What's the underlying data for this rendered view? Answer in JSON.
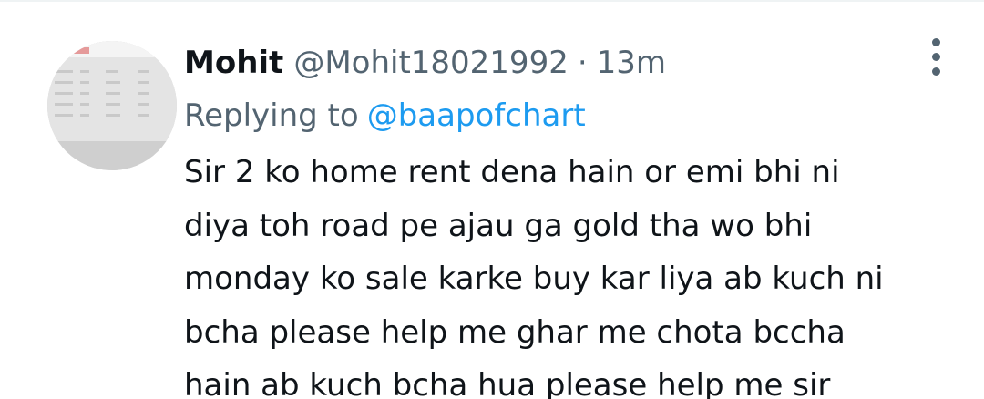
{
  "tweet": {
    "author_name": "Mohit",
    "author_handle": "@Mohit18021992",
    "separator": "·",
    "timestamp": "13m",
    "reply_prefix": "Replying to",
    "reply_handle": "@baapofchart",
    "body_lines": [
      "Sir 2 ko home rent dena hain or emi bhi ni",
      "diya toh road pe ajau ga gold tha wo bhi",
      "monday ko sale karke buy kar liya ab kuch ni",
      "bcha please help me ghar me chota bccha",
      "hain ab kuch bcha hua please help me sir"
    ]
  },
  "icons": {
    "more": "more-options-icon"
  },
  "colors": {
    "text_primary": "#0f1419",
    "text_secondary": "#536471",
    "link": "#1d9bf0",
    "divider": "#eff3f4"
  }
}
